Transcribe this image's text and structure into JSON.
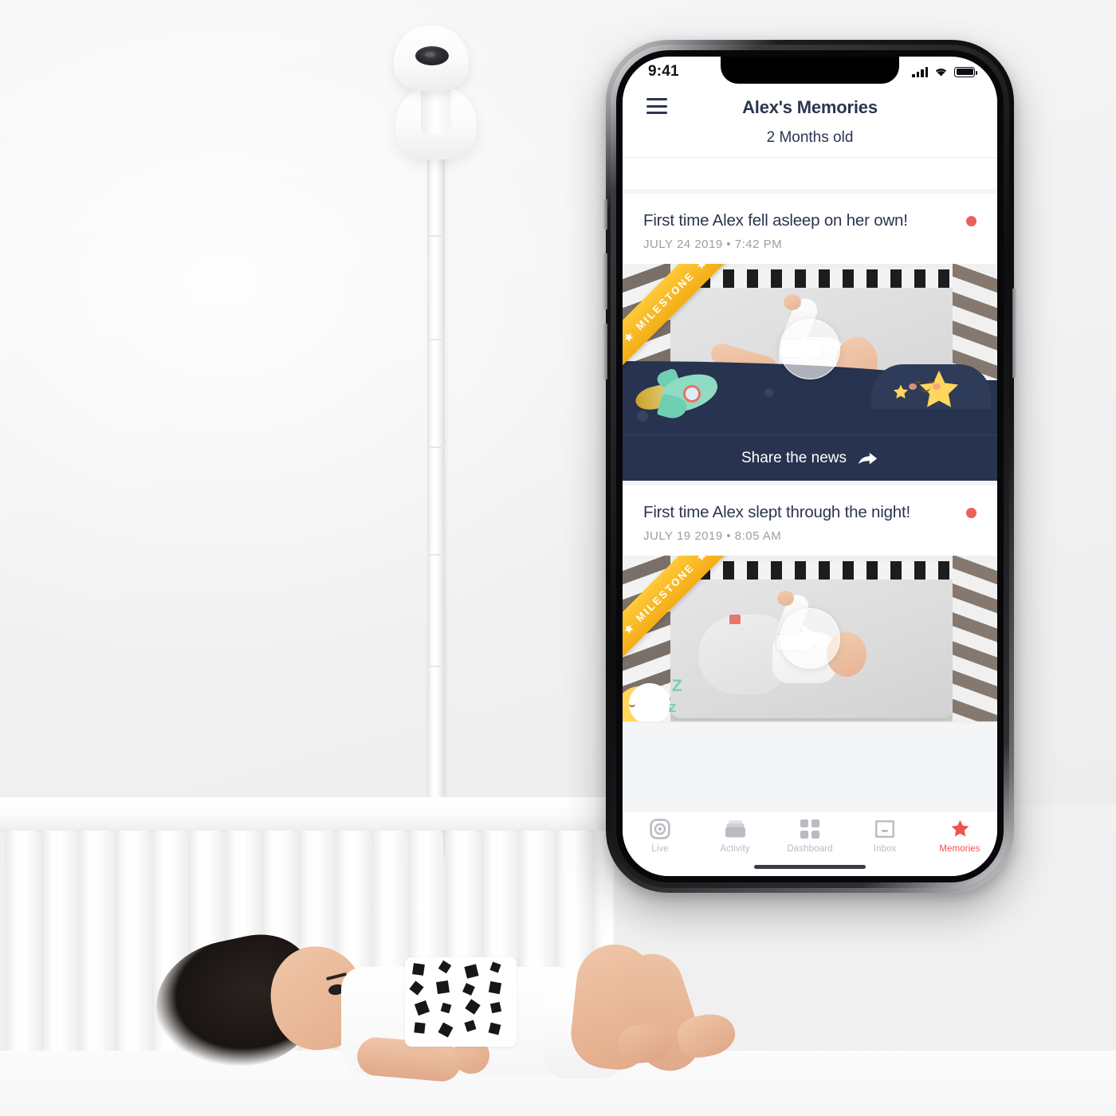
{
  "scene": {
    "description": "nursery-photo-background",
    "camera_device": "baby-monitor-camera",
    "crib": "white-slatted-crib",
    "baby": "infant-lying-in-crib"
  },
  "phone": {
    "status_bar": {
      "time": "9:41",
      "signal_icon": "cellular-signal-icon",
      "wifi_icon": "wifi-icon",
      "battery_icon": "battery-full-icon"
    },
    "header": {
      "menu_icon": "hamburger-menu-icon",
      "title": "Alex's Memories",
      "subtitle": "2 Months old"
    },
    "feed": {
      "cards": [
        {
          "title": "First time Alex fell asleep on her own!",
          "date": "JULY 24 2019 • 7:42 PM",
          "unread_dot": true,
          "ribbon_label": "MILESTONE",
          "play_icon": "play-button-icon",
          "share_label": "Share the news",
          "share_icon": "share-arrow-icon",
          "illustration": "rocket-and-stars-night-scene"
        },
        {
          "title": "First time Alex slept through the night!",
          "date": "JULY 19 2019 • 8:05 AM",
          "unread_dot": true,
          "ribbon_label": "MILESTONE",
          "play_icon": "play-button-icon",
          "illustration": "sleeping-moon-with-zzz",
          "zzz": [
            "Z",
            "Z"
          ]
        }
      ]
    },
    "tabbar": {
      "tabs": [
        {
          "label": "Live",
          "icon": "live-target-icon",
          "active": false
        },
        {
          "label": "Activity",
          "icon": "activity-cards-icon",
          "active": false
        },
        {
          "label": "Dashboard",
          "icon": "dashboard-grid-icon",
          "active": false
        },
        {
          "label": "Inbox",
          "icon": "inbox-tray-icon",
          "active": false
        },
        {
          "label": "Memories",
          "icon": "memories-star-icon",
          "active": true
        }
      ]
    }
  },
  "colors": {
    "navy": "#2c3550",
    "accent_red": "#ef5350",
    "dot_red": "#ec5f5f",
    "ribbon_yellow": "#ffc938",
    "space_navy": "#27334f",
    "rocket_mint": "#8fdcc3",
    "star_yellow": "#ffd65e",
    "zzz_teal": "#73cdb6",
    "tab_inactive": "#b9bcc2"
  }
}
